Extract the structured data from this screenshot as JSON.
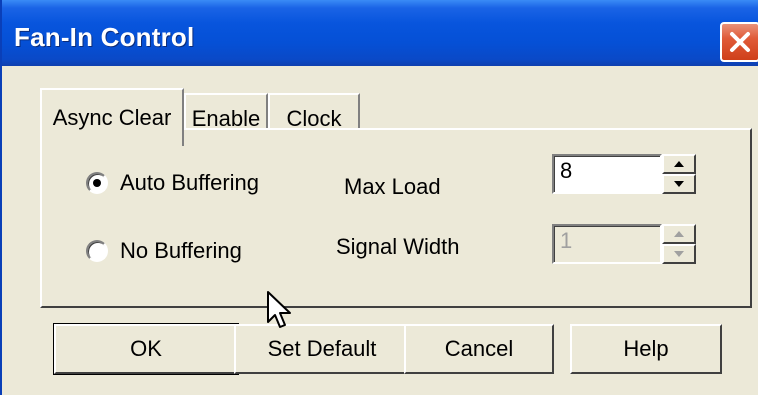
{
  "window": {
    "title": "Fan-In Control"
  },
  "tabs": [
    {
      "label": "Async Clear",
      "active": true
    },
    {
      "label": "Enable",
      "active": false
    },
    {
      "label": "Clock",
      "active": false
    }
  ],
  "options": {
    "auto_buffering": {
      "label": "Auto Buffering",
      "selected": true
    },
    "no_buffering": {
      "label": "No Buffering",
      "selected": false
    }
  },
  "fields": {
    "max_load": {
      "label": "Max Load",
      "value": "8",
      "enabled": true
    },
    "signal_width": {
      "label": "Signal Width",
      "value": "1",
      "enabled": false
    }
  },
  "buttons": {
    "ok": "OK",
    "set_default": "Set Default",
    "cancel": "Cancel",
    "help": "Help"
  },
  "colors": {
    "titlebar": "#0855dd",
    "close_button": "#e05b38",
    "dialog_background": "#ece9d8"
  },
  "icons": [
    "close-icon",
    "spin-up-arrow-icon",
    "spin-down-arrow-icon",
    "mouse-pointer-icon"
  ]
}
